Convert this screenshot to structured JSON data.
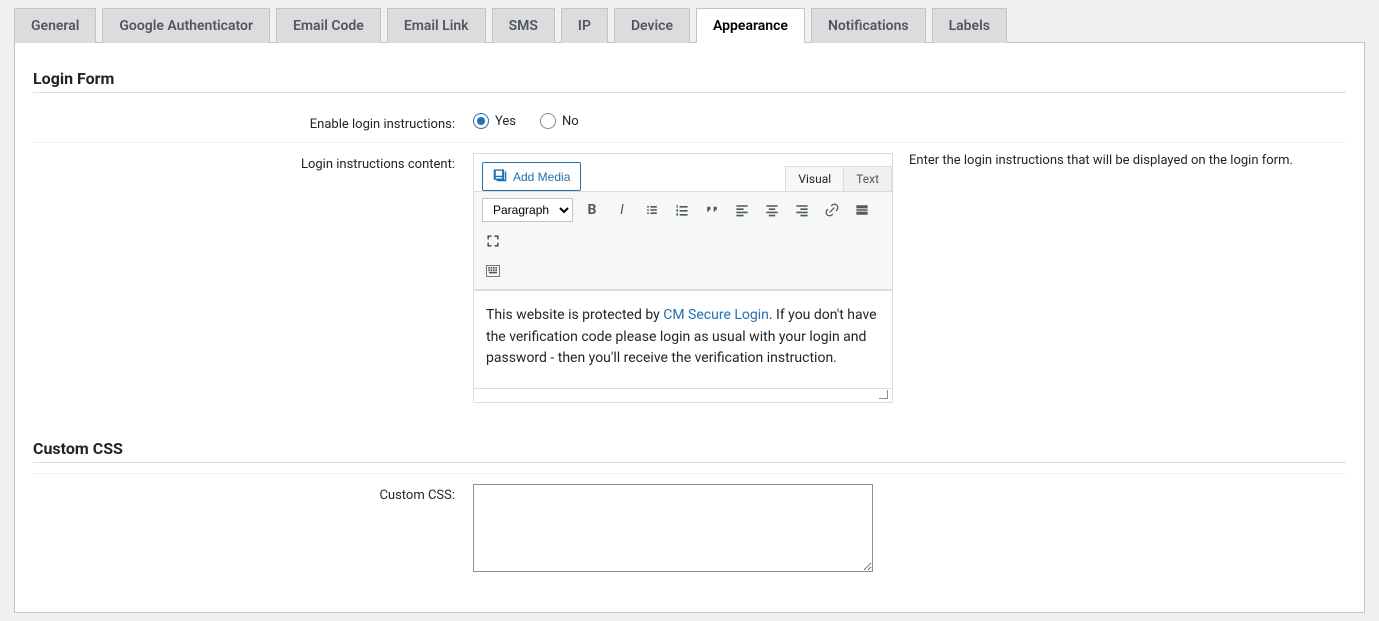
{
  "tabs": [
    {
      "label": "General",
      "active": false
    },
    {
      "label": "Google Authenticator",
      "active": false
    },
    {
      "label": "Email Code",
      "active": false
    },
    {
      "label": "Email Link",
      "active": false
    },
    {
      "label": "SMS",
      "active": false
    },
    {
      "label": "IP",
      "active": false
    },
    {
      "label": "Device",
      "active": false
    },
    {
      "label": "Appearance",
      "active": true
    },
    {
      "label": "Notifications",
      "active": false
    },
    {
      "label": "Labels",
      "active": false
    }
  ],
  "sections": {
    "login_form": {
      "heading": "Login Form",
      "enable_label": "Enable login instructions:",
      "enable_options": {
        "yes": "Yes",
        "no": "No",
        "selected": "yes"
      },
      "content_label": "Login instructions content:",
      "content_desc": "Enter the login instructions that will be displayed on the login form.",
      "editor": {
        "add_media": "Add Media",
        "tabs": {
          "visual": "Visual",
          "text": "Text",
          "active": "visual"
        },
        "format_select": "Paragraph",
        "body_before": "This website is protected by ",
        "body_link": "CM Secure Login",
        "body_after": ". If you don't have the verification code please login as usual with your login and password - then you'll receive the verification instruction."
      }
    },
    "custom_css": {
      "heading": "Custom CSS",
      "label": "Custom CSS:",
      "value": ""
    }
  }
}
